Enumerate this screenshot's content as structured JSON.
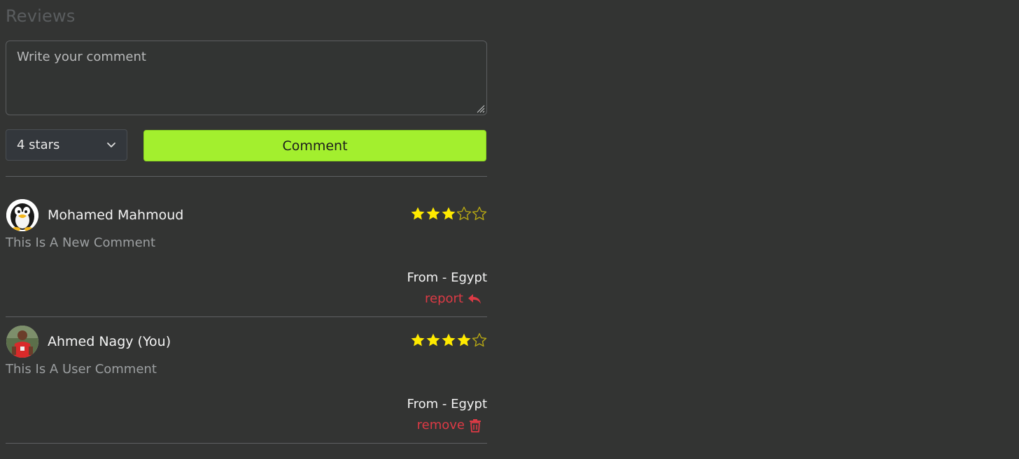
{
  "reviews_section": {
    "title": "Reviews",
    "comment_placeholder": "Write your comment",
    "rating_select_value": "4 stars",
    "submit_label": "Comment"
  },
  "reviews": [
    {
      "author": "Mohamed Mahmoud",
      "avatar": "penguin-avatar",
      "rating": 3,
      "max_rating": 5,
      "comment": "This Is A New Comment",
      "origin": "From - Egypt",
      "action_label": "report",
      "action_icon": "reply-arrow-icon"
    },
    {
      "author": "Ahmed Nagy (You)",
      "avatar": "user-photo-avatar",
      "rating": 4,
      "max_rating": 5,
      "comment": "This Is A User Comment",
      "origin": "From - Egypt",
      "action_label": "remove",
      "action_icon": "trash-icon"
    }
  ],
  "colors": {
    "background": "#333433",
    "accent": "#a3ef2e",
    "star": "#ffea00",
    "danger": "#dc3a45"
  }
}
